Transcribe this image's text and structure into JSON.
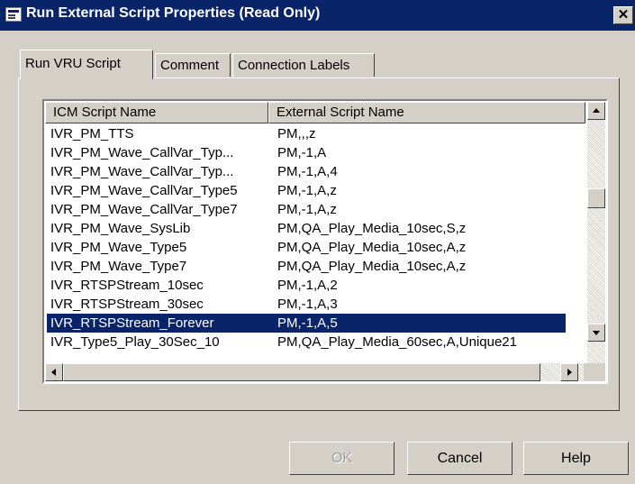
{
  "window": {
    "title": "Run External Script Properties (Read Only)",
    "close_glyph": "✕"
  },
  "tabs": [
    {
      "label": "Run VRU Script",
      "active": true
    },
    {
      "label": "Comment",
      "active": false
    },
    {
      "label": "Connection Labels",
      "active": false
    }
  ],
  "list": {
    "columns": [
      "ICM Script Name",
      "External Script Name"
    ],
    "rows": [
      {
        "icm": "IVR_PM_TTS",
        "ext": "PM,,,z"
      },
      {
        "icm": "IVR_PM_Wave_CallVar_Typ...",
        "ext": "PM,-1,A"
      },
      {
        "icm": "IVR_PM_Wave_CallVar_Typ...",
        "ext": "PM,-1,A,4"
      },
      {
        "icm": "IVR_PM_Wave_CallVar_Type5",
        "ext": "PM,-1,A,z"
      },
      {
        "icm": "IVR_PM_Wave_CallVar_Type7",
        "ext": "PM,-1,A,z"
      },
      {
        "icm": "IVR_PM_Wave_SysLib",
        "ext": "PM,QA_Play_Media_10sec,S,z"
      },
      {
        "icm": "IVR_PM_Wave_Type5",
        "ext": "PM,QA_Play_Media_10sec,A,z"
      },
      {
        "icm": "IVR_PM_Wave_Type7",
        "ext": "PM,QA_Play_Media_10sec,A,z"
      },
      {
        "icm": "IVR_RTSPStream_10sec",
        "ext": "PM,-1,A,2"
      },
      {
        "icm": "IVR_RTSPStream_30sec",
        "ext": "PM,-1,A,3"
      },
      {
        "icm": "IVR_RTSPStream_Forever",
        "ext": "PM,-1,A,5"
      },
      {
        "icm": "IVR_Type5_Play_30Sec_10",
        "ext": "PM,QA_Play_Media_60sec,A,Unique21"
      }
    ],
    "selected_index": 10
  },
  "buttons": {
    "ok": "OK",
    "cancel": "Cancel",
    "help": "Help"
  },
  "colors": {
    "titlebar": "#0a246a",
    "selection": "#0a246a",
    "face": "#d4d0c8"
  }
}
